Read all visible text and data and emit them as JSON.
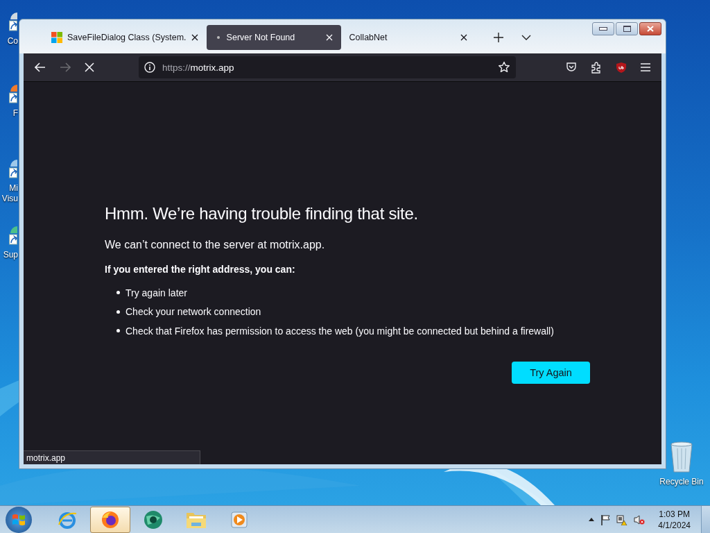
{
  "desktop_icons": [
    {
      "lines": [
        "Co"
      ]
    },
    {
      "lines": [
        "F"
      ]
    },
    {
      "lines": [
        "Mi",
        "Visu"
      ]
    },
    {
      "lines": [
        "Sup"
      ]
    }
  ],
  "recycle_bin": {
    "label": "Recycle Bin"
  },
  "browser": {
    "tabs": [
      {
        "title": "SaveFileDialog Class (System.",
        "selected": false,
        "loading": false
      },
      {
        "title": "Server Not Found",
        "selected": true,
        "loading": true
      },
      {
        "title": "CollabNet",
        "selected": false,
        "loading": false
      }
    ],
    "toolbar": {
      "back_disabled": false,
      "forward_disabled": true,
      "loading": true,
      "url_scheme": "https://",
      "url_host": "motrix.app"
    },
    "error": {
      "title": "Hmm. We’re having trouble finding that site.",
      "message": "We can’t connect to the server at motrix.app.",
      "list_heading": "If you entered the right address, you can:",
      "suggestions": [
        "Try again later",
        "Check your network connection",
        "Check that Firefox has permission to access the web (you might be connected but behind a firewall)"
      ],
      "button": "Try Again"
    },
    "status_link": "motrix.app"
  },
  "taskbar": {
    "apps": [
      {
        "kind": "ie",
        "selected": false
      },
      {
        "kind": "firefox",
        "selected": true
      },
      {
        "kind": "globe",
        "selected": false
      },
      {
        "kind": "folder",
        "selected": false
      },
      {
        "kind": "media",
        "selected": false
      }
    ],
    "time": "1:03 PM",
    "date": "4/1/2024"
  }
}
